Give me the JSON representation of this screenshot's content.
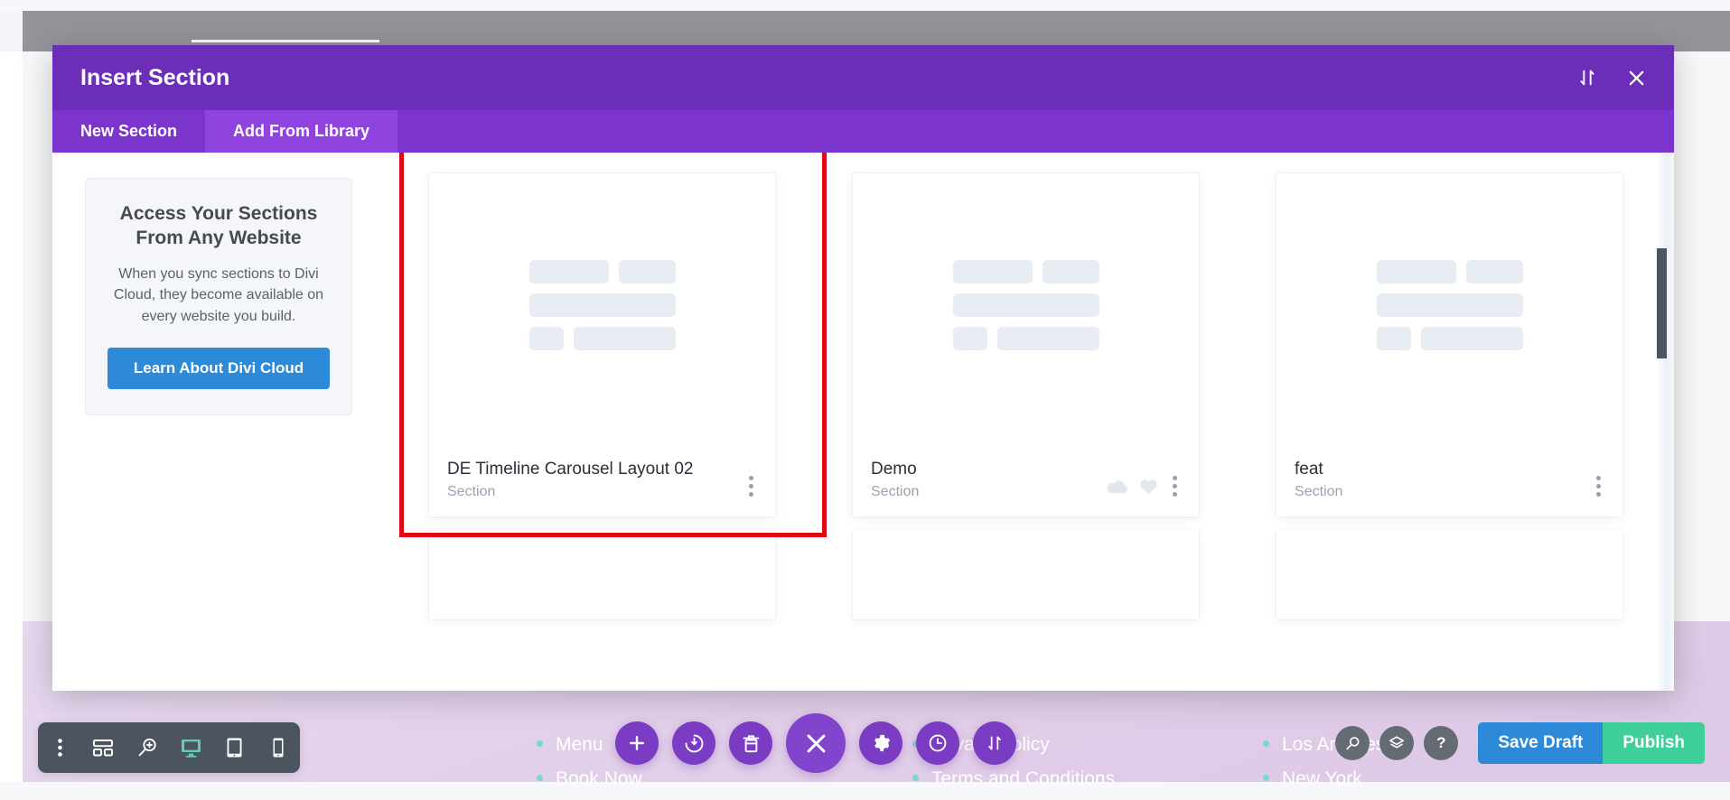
{
  "modal": {
    "title": "Insert Section",
    "header_icons": [
      {
        "name": "sort-icon",
        "glyph": "sort"
      },
      {
        "name": "close-icon",
        "glyph": "close"
      }
    ],
    "tabs": [
      {
        "label": "New Section",
        "active": false
      },
      {
        "label": "Add From Library",
        "active": true
      }
    ],
    "sidebar": {
      "promo_title": "Access Your Sections From Any Website",
      "promo_text": "When you sync sections to Divi Cloud, they become available on every website you build.",
      "promo_button": "Learn About Divi Cloud"
    },
    "cards": [
      {
        "name": "DE Timeline Carousel Layout 02",
        "type": "Section",
        "selected": true,
        "has_cloud_icon": false,
        "has_heart_icon": false
      },
      {
        "name": "Demo",
        "type": "Section",
        "selected": false,
        "has_cloud_icon": true,
        "has_heart_icon": true
      },
      {
        "name": "feat",
        "type": "Section",
        "selected": false,
        "has_cloud_icon": false,
        "has_heart_icon": false
      }
    ],
    "selection_highlight_color": "#e30613",
    "accent_color": "#6c2eb9"
  },
  "page_background": {
    "footer_columns": [
      {
        "links": [
          "Menu",
          "Book Now"
        ]
      },
      {
        "links": [
          "Privacy Policy",
          "Terms and Conditions"
        ]
      },
      {
        "links": [
          "Los Angeles",
          "New York"
        ]
      }
    ]
  },
  "toolbar": {
    "left_tools": [
      {
        "name": "more-vertical-icon"
      },
      {
        "name": "wireframe-icon"
      },
      {
        "name": "zoom-out-icon"
      },
      {
        "name": "desktop-icon",
        "active": true
      },
      {
        "name": "tablet-icon"
      },
      {
        "name": "mobile-icon"
      }
    ],
    "center_tools": [
      {
        "name": "add-icon"
      },
      {
        "name": "history-undo-icon"
      },
      {
        "name": "trash-icon"
      },
      {
        "name": "close-builder-icon",
        "big": true
      },
      {
        "name": "settings-gear-icon"
      },
      {
        "name": "clock-icon"
      },
      {
        "name": "sort-icon"
      }
    ],
    "right_tools": [
      {
        "name": "search-icon",
        "glyph": "search"
      },
      {
        "name": "layers-icon",
        "glyph": "layers"
      },
      {
        "name": "help-icon",
        "glyph": "?"
      }
    ],
    "save_draft_label": "Save Draft",
    "publish_label": "Publish",
    "save_draft_color": "#2d8ad8",
    "publish_color": "#3ecf9b"
  }
}
